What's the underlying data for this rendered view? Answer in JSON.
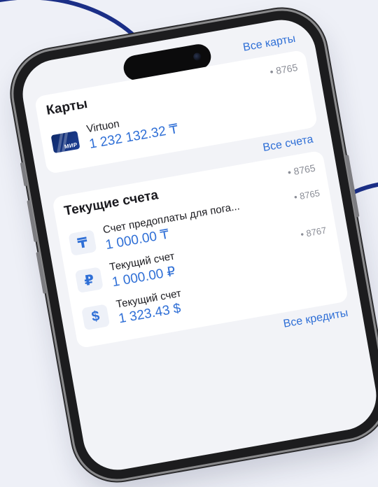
{
  "cards_section": {
    "all_cards_link": "Все карты",
    "title": "Карты",
    "account_suffix": "• 8765",
    "items": [
      {
        "name": "Virtuon",
        "amount": "1 232 132.32 ₸",
        "brand": "МИР",
        "icon": "mir-card-icon"
      }
    ]
  },
  "accounts_section": {
    "all_accounts_link": "Все счета",
    "title": "Текущие счета",
    "account_suffix": "• 8765",
    "items": [
      {
        "name": "Счет предоплаты для пога...",
        "amount": "1 000.00 ₸",
        "icon_glyph": "₸",
        "icon": "tenge-icon",
        "suffix": "• 8765"
      },
      {
        "name": "Текущий счет",
        "amount": "1 000.00 ₽",
        "icon_glyph": "₽",
        "icon": "ruble-icon",
        "suffix": "• 8767"
      },
      {
        "name": "Текущий счет",
        "amount": "1 323.43 $",
        "icon_glyph": "$",
        "icon": "dollar-icon",
        "suffix": ""
      }
    ]
  },
  "credits_section": {
    "all_credits_link": "Все кредиты"
  },
  "colors": {
    "accent": "#2f6fd6",
    "background": "#eef0f7",
    "decor_line": "#1b2f87"
  }
}
